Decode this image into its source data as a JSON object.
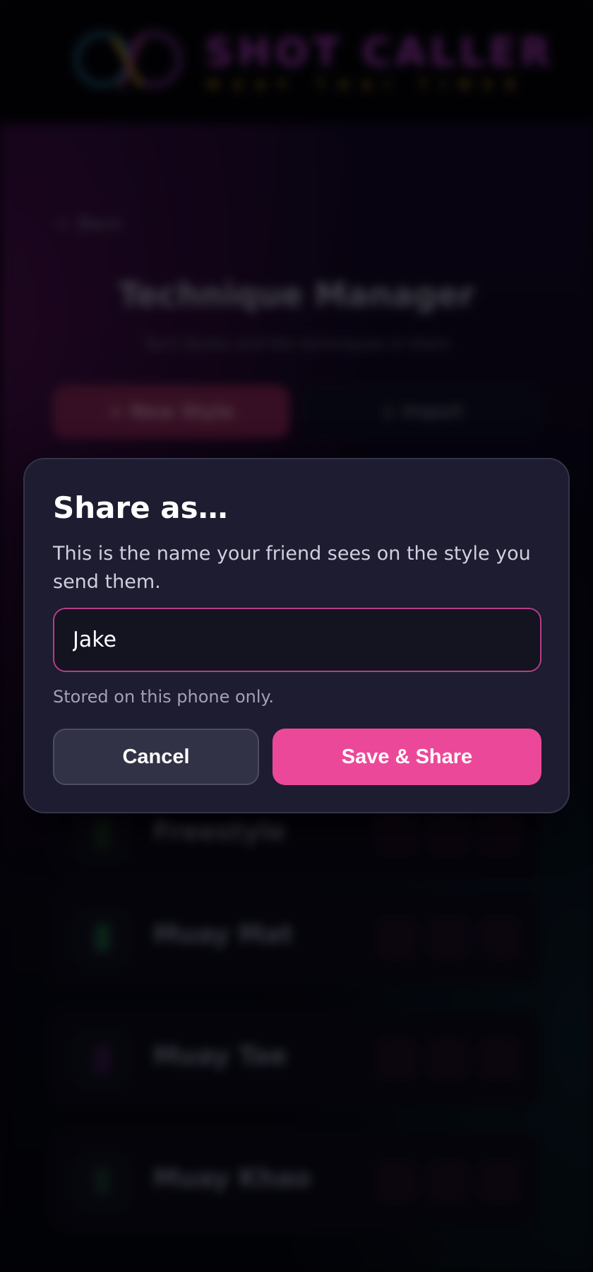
{
  "header": {
    "logo_title": "SHOT CALLER",
    "logo_tagline": "MUAY THAI TIMER"
  },
  "page": {
    "back_label": "← Back",
    "title": "Technique Manager",
    "subtitle": "Tech Styles and the techniques in them",
    "new_style_label": "+ New Style",
    "import_label": "↓ Import",
    "styles": [
      {
        "name": "Freestyle"
      },
      {
        "name": "Muay Mat"
      },
      {
        "name": "Muay Tae"
      },
      {
        "name": "Muay Khao"
      }
    ]
  },
  "modal": {
    "title": "Share as…",
    "description": "This is the name your friend sees on the style you send them.",
    "input_value": "Jake",
    "hint": "Stored on this phone only.",
    "cancel_label": "Cancel",
    "save_label": "Save & Share"
  },
  "colors": {
    "accent": "#ec4899",
    "modal_bg": "#1d1c30",
    "input_border": "#b43e86",
    "page_bg": "#05050d"
  },
  "icons": [
    "logo-icon",
    "arrow-left-icon",
    "plus-icon",
    "download-icon",
    "edit-icon",
    "share-icon",
    "delete-icon"
  ]
}
